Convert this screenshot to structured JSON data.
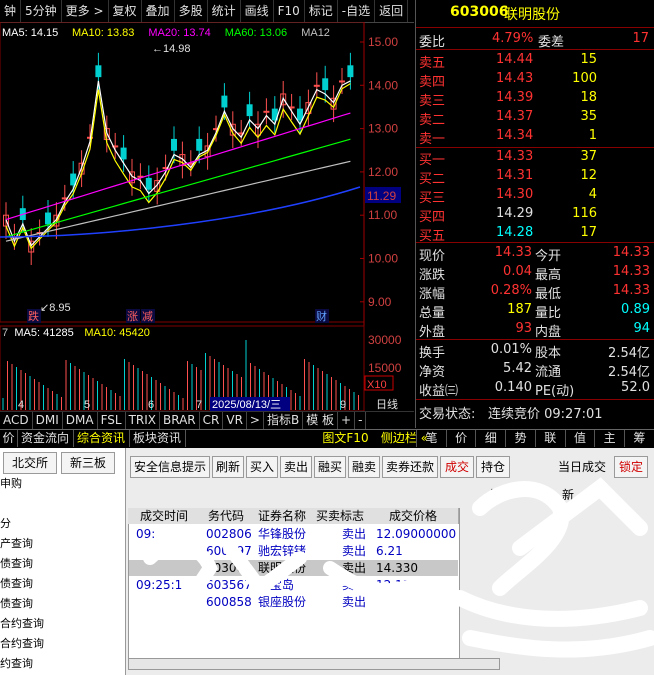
{
  "toolbar": {
    "items": [
      "钟",
      "5分钟",
      "更多 >",
      "复权",
      "叠加",
      "多股",
      "统计",
      "画线",
      "F10",
      "标记",
      "-自选",
      "返回"
    ]
  },
  "chart": {
    "ma_legend": [
      {
        "label": "MA5: 14.15",
        "color": "#ffffff"
      },
      {
        "label": "MA10: 13.83",
        "color": "#ffff00"
      },
      {
        "label": "MA20: 13.74",
        "color": "#ff00ff"
      },
      {
        "label": "MA60: 13.06",
        "color": "#00ff00"
      },
      {
        "label": "MA12",
        "color": "#c0c0c0"
      }
    ],
    "price_ticks": [
      "15.00",
      "14.00",
      "13.00",
      "12.00",
      "11.00",
      "10.00",
      "9.00"
    ],
    "current_price_tag": "11.29",
    "high_annotation": "14.98",
    "low_annotation": "8.95",
    "event_markers": [
      "跌",
      "涨",
      "减",
      "财"
    ],
    "volume_legend": [
      {
        "label": "7",
        "color": "#c0c0c0"
      },
      {
        "label": "MA5: 41285",
        "color": "#ffffff"
      },
      {
        "label": "MA10: 45420",
        "color": "#ffff00"
      }
    ],
    "volume_ticks": [
      "30000",
      "15000"
    ],
    "volume_unit": "X10",
    "date_labels": [
      "4",
      "5",
      "6",
      "7",
      "8",
      "9"
    ],
    "cursor_date": "2025/08/13/三",
    "x_axis_title": "日线"
  },
  "indicator_tabs": [
    "ACD",
    "DMI",
    "DMA",
    "FSL",
    "TRIX",
    "BRAR",
    "CR",
    "VR",
    ">",
    "指标B",
    "模 板",
    "+",
    "-"
  ],
  "quote": {
    "code": "603006",
    "name": "联明股份",
    "webi_label": "委比",
    "webi_value": "4.79%",
    "weicha_label": "委差",
    "weicha_value": "17",
    "asks": [
      {
        "label": "卖五",
        "price": "14.44",
        "vol": "15"
      },
      {
        "label": "卖四",
        "price": "14.43",
        "vol": "100"
      },
      {
        "label": "卖三",
        "price": "14.39",
        "vol": "18"
      },
      {
        "label": "卖二",
        "price": "14.37",
        "vol": "35"
      },
      {
        "label": "卖一",
        "price": "14.34",
        "vol": "1"
      }
    ],
    "bids": [
      {
        "label": "买一",
        "price": "14.33",
        "vol": "37"
      },
      {
        "label": "买二",
        "price": "14.31",
        "vol": "12"
      },
      {
        "label": "买三",
        "price": "14.30",
        "vol": "4"
      },
      {
        "label": "买四",
        "price": "14.29",
        "vol": "116"
      },
      {
        "label": "买五",
        "price": "14.28",
        "vol": "17"
      }
    ],
    "stats": [
      {
        "l1": "现价",
        "v1": "14.33",
        "l2": "今开",
        "v2": "14.33",
        "c1": "red",
        "c2": "red"
      },
      {
        "l1": "涨跌",
        "v1": "0.04",
        "l2": "最高",
        "v2": "14.33",
        "c1": "red",
        "c2": "red"
      },
      {
        "l1": "涨幅",
        "v1": "0.28%",
        "l2": "最低",
        "v2": "14.33",
        "c1": "red",
        "c2": "red"
      },
      {
        "l1": "总量",
        "v1": "187",
        "l2": "量比",
        "v2": "0.89",
        "c1": "yel",
        "c2": "cyan"
      },
      {
        "l1": "外盘",
        "v1": "93",
        "l2": "内盘",
        "v2": "94",
        "c1": "red",
        "c2": "cyan"
      }
    ],
    "stats2": [
      {
        "l1": "换手",
        "v1": "0.01%",
        "l2": "股本",
        "v2": "2.54亿"
      },
      {
        "l1": "净资",
        "v1": "5.42",
        "l2": "流通",
        "v2": "2.54亿"
      },
      {
        "l1": "收益㈢",
        "v1": "0.140",
        "l2": "PE(动)",
        "v2": "52.0"
      }
    ],
    "trade_status_label": "交易状态:",
    "trade_status_value": "连续竞价 09:27:01"
  },
  "bottom_tabs": {
    "left": [
      "价",
      "资金流向",
      "综合资讯",
      "板块资讯"
    ],
    "right": [
      "图文F10",
      "侧边栏 «"
    ],
    "quote_tabs": [
      "笔",
      "价",
      "细",
      "势",
      "联",
      "值",
      "主",
      "筹"
    ]
  },
  "trade_panel": {
    "market_tabs": [
      "北交所",
      "新三板"
    ],
    "menu": [
      "申购",
      "",
      "分",
      "产查询",
      "债查询",
      "债查询",
      "债查询",
      "合约查询",
      "合约查询",
      "约查询"
    ],
    "buttons": [
      "安全信息提示",
      "刷新",
      "买入",
      "卖出",
      "融买",
      "融卖",
      "卖券还款",
      "成交",
      "持仓"
    ],
    "side_labels": [
      "当日成交",
      "锁定"
    ],
    "columns": [
      "成交时间",
      "务代码",
      "证券名称",
      "买卖标志",
      "成交价格"
    ],
    "rows": [
      {
        "time": "09:",
        "code": "002806",
        "name": "华锋股份",
        "side": "卖出",
        "price": "12.09000000"
      },
      {
        "time": "",
        "code": "600497",
        "name": "驰宏锌锗",
        "side": "卖出",
        "price": "6.21"
      },
      {
        "time": "",
        "code": "603006",
        "name": "联明股份",
        "side": "卖出",
        "price": "14.330"
      },
      {
        "time": "09:25:1",
        "code": "603567",
        "name": "珍宝岛",
        "side": "卖出",
        "price": "12.1300"
      },
      {
        "time": "",
        "code": "600858",
        "name": "银座股份",
        "side": "卖出",
        "price": ""
      }
    ],
    "extra_chars": [
      "共",
      "新"
    ]
  }
}
